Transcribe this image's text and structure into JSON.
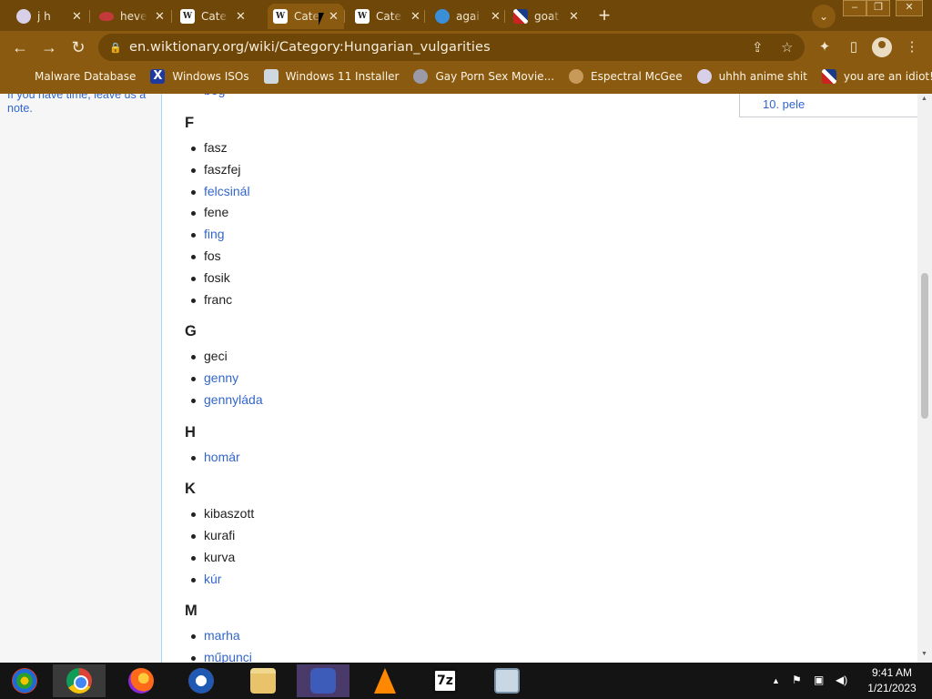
{
  "browser": {
    "tabs": [
      {
        "title": "j h",
        "favicon": "anime-icon"
      },
      {
        "title": "heve",
        "favicon": "lips-icon"
      },
      {
        "title": "Cate",
        "favicon": "wiki-icon"
      },
      {
        "title": "Cate",
        "favicon": "wiki-icon"
      },
      {
        "title": "Cate",
        "favicon": "wiki-icon"
      },
      {
        "title": "agai",
        "favicon": "telegram-icon"
      },
      {
        "title": "goat",
        "favicon": "uk-flag-icon"
      }
    ],
    "close_glyph": "✕",
    "url": "en.wiktionary.org/wiki/Category:Hungarian_vulgarities",
    "theme_color": "#8a5a10"
  },
  "bookmarks": [
    {
      "label": "Malware Database",
      "icon": "blank-icon"
    },
    {
      "label": "Windows ISOs",
      "icon": "x-icon"
    },
    {
      "label": "Windows 11 Installer",
      "icon": "windows-installer-icon"
    },
    {
      "label": "Gay Porn Sex Movie...",
      "icon": "gear-icon"
    },
    {
      "label": "Espectral McGee",
      "icon": "face-icon"
    },
    {
      "label": "uhhh anime shit",
      "icon": "anime-icon"
    },
    {
      "label": "you are an idiot!",
      "icon": "uk-flag-icon"
    }
  ],
  "sidebar": {
    "note": "If you have time, leave us a note."
  },
  "toc": {
    "last_item": "10. pele"
  },
  "content": {
    "cut_word": "bog",
    "sections": [
      {
        "letter": "F",
        "words": [
          {
            "text": "fasz",
            "link": false
          },
          {
            "text": "faszfej",
            "link": false
          },
          {
            "text": "felcsinál",
            "link": true
          },
          {
            "text": "fene",
            "link": false
          },
          {
            "text": "fing",
            "link": true
          },
          {
            "text": "fos",
            "link": false
          },
          {
            "text": "fosik",
            "link": false
          },
          {
            "text": "franc",
            "link": false
          }
        ]
      },
      {
        "letter": "G",
        "words": [
          {
            "text": "geci",
            "link": false
          },
          {
            "text": "genny",
            "link": true
          },
          {
            "text": "gennyláda",
            "link": true
          }
        ]
      },
      {
        "letter": "H",
        "words": [
          {
            "text": "homár",
            "link": true
          }
        ]
      },
      {
        "letter": "K",
        "words": [
          {
            "text": "kibaszott",
            "link": false
          },
          {
            "text": "kurafi",
            "link": false
          },
          {
            "text": "kurva",
            "link": false
          },
          {
            "text": "kúr",
            "link": true
          }
        ]
      },
      {
        "letter": "M",
        "words": [
          {
            "text": "marha",
            "link": true
          },
          {
            "text": "műpunci",
            "link": true
          }
        ]
      }
    ]
  },
  "taskbar": {
    "apps": [
      "start-orb-icon",
      "chrome-icon",
      "firefox-icon",
      "obama-icon",
      "file-explorer-icon",
      "network-icon",
      "vlc-icon",
      "7zip-icon",
      "performance-monitor-icon"
    ],
    "sevenzip_label": "7z",
    "clock_time": "9:41 AM",
    "clock_date": "1/21/2023"
  }
}
